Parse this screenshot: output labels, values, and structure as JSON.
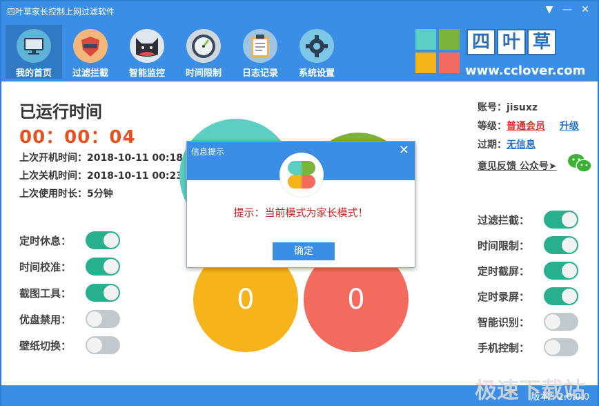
{
  "window": {
    "title": "四叶草家长控制上网过滤软件",
    "menu_glyph": "▼",
    "minimize_glyph": "—",
    "close_glyph": "✕"
  },
  "nav": {
    "items": [
      {
        "label": "我的首页",
        "icon": "monitor-icon",
        "active": true
      },
      {
        "label": "过滤拦截",
        "icon": "shield-icon",
        "active": false
      },
      {
        "label": "智能监控",
        "icon": "cat-face-icon",
        "active": false
      },
      {
        "label": "时间限制",
        "icon": "clock-icon",
        "active": false
      },
      {
        "label": "日志记录",
        "icon": "clipboard-icon",
        "active": false
      },
      {
        "label": "系统设置",
        "icon": "gear-icon",
        "active": false
      }
    ]
  },
  "brand": {
    "chars": [
      "四",
      "叶",
      "草"
    ],
    "url": "www.cclover.com"
  },
  "runtime": {
    "title": "已运行时间",
    "elapsed": "00：00：04",
    "last_boot": "上次开机时间：2018-10-11 00:18",
    "last_shutdown": "上次关机时间：2018-10-11 00:23",
    "last_duration": "上次使用时长：5分钟"
  },
  "left_toggles": [
    {
      "label": "定时休息：",
      "on": true
    },
    {
      "label": "时间校准：",
      "on": true
    },
    {
      "label": "截图工具：",
      "on": true
    },
    {
      "label": "优盘禁用：",
      "on": false
    },
    {
      "label": "壁纸切换：",
      "on": false
    }
  ],
  "account": {
    "account_label": "账号：",
    "account_value": "jisuxz",
    "level_label": "等级：",
    "level_value": "普通会员",
    "upgrade": "升级",
    "expire_label": "过期：",
    "expire_value": "无信息",
    "feedback": "意见反馈 公众号➤"
  },
  "right_toggles": [
    {
      "label": "过滤拦截：",
      "on": true
    },
    {
      "label": "时间限制：",
      "on": true
    },
    {
      "label": "定时截屏：",
      "on": true
    },
    {
      "label": "定时录屏：",
      "on": true
    },
    {
      "label": "智能识别：",
      "on": false
    },
    {
      "label": "手机控制：",
      "on": false
    }
  ],
  "circles": {
    "yellow_value": "0",
    "red_value": "0"
  },
  "dialog": {
    "title": "信息提示",
    "message": "提示：当前模式为家长模式！",
    "ok": "确定",
    "close_glyph": "✕"
  },
  "footer": {
    "watermark": "极速下载站",
    "version": "版本：2.0.0.0"
  },
  "colors": {
    "header": "#3a8ee6",
    "toggle_on": "#28b08c",
    "toggle_off": "#c3c8cc",
    "timer": "#e8501e",
    "yellow": "#f6b31a",
    "red": "#f36b5f",
    "teal": "#5bcfc4",
    "green": "#7bb33c"
  }
}
